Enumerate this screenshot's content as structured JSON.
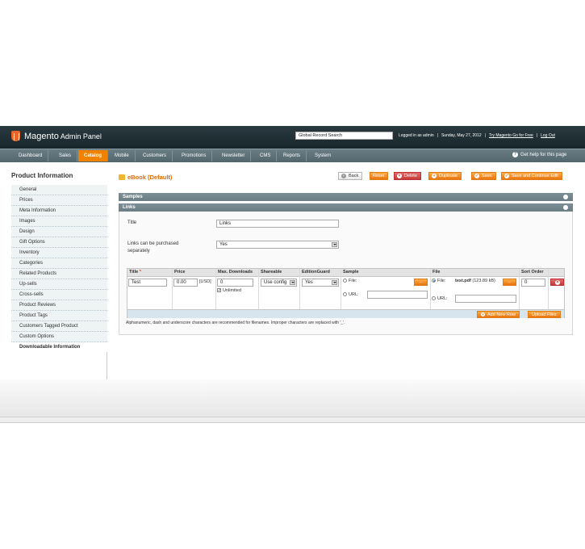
{
  "header": {
    "logo_text": "Magento",
    "logo_sub": "Admin Panel",
    "global_search": "Global Record Search",
    "logged_in_as": "Logged in as admin",
    "date": "Sunday, May 27, 2012",
    "try_link": "Try Magento Go for Free",
    "logout": "Log Out"
  },
  "nav": {
    "items": [
      "Dashboard",
      "Sales",
      "Catalog",
      "Mobile",
      "Customers",
      "Promotions",
      "Newsletter",
      "CMS",
      "Reports",
      "System"
    ],
    "active": "Catalog",
    "help": "Get help for this page"
  },
  "sidebar": {
    "title": "Product Information",
    "items": [
      "General",
      "Prices",
      "Meta Information",
      "Images",
      "Design",
      "Gift Options",
      "Inventory",
      "Categories",
      "Related Products",
      "Up-sells",
      "Cross-sells",
      "Product Reviews",
      "Product Tags",
      "Customers Tagged Product",
      "Custom Options",
      "Downloadable Information"
    ],
    "active": "Downloadable Information"
  },
  "content": {
    "title": "eBook (Default)",
    "buttons": {
      "back": "Back",
      "reset": "Reset",
      "delete": "Delete",
      "duplicate": "Duplicate",
      "save": "Save",
      "save_continue": "Save and Continue Edit"
    }
  },
  "samples": {
    "title": "Samples"
  },
  "links": {
    "title": "Links",
    "title_label": "Title",
    "title_value": "Links",
    "separately_label": "Links can be purchased separately",
    "separately_value": "Yes",
    "grid": {
      "headers": {
        "title": "Title",
        "required_mark": "*",
        "price": "Price",
        "max_downloads": "Max. Downloads",
        "shareable": "Shareable",
        "edition_guard": "EditionGuard",
        "sample": "Sample",
        "file": "File",
        "sort_order": "Sort Order"
      },
      "row": {
        "title": "Test",
        "price": "0.00",
        "currency": "[USD]",
        "max_downloads": "0",
        "unlimited_label": "Unlimited",
        "shareable": "Use config",
        "edition_guard": "Yes",
        "sample_file_label": "File:",
        "sample_url_label": "URL:",
        "file_label": "File:",
        "file_name": "test.pdf",
        "file_size": "(123.89 kB)",
        "file_url_label": "URL:",
        "sort_order": "0",
        "browse": "..."
      },
      "add_row": "Add New Row",
      "upload_files": "Upload Files"
    },
    "note": "Alphanumeric, dash and underscore characters are recommended for filenames. Improper characters are replaced with '_'."
  }
}
